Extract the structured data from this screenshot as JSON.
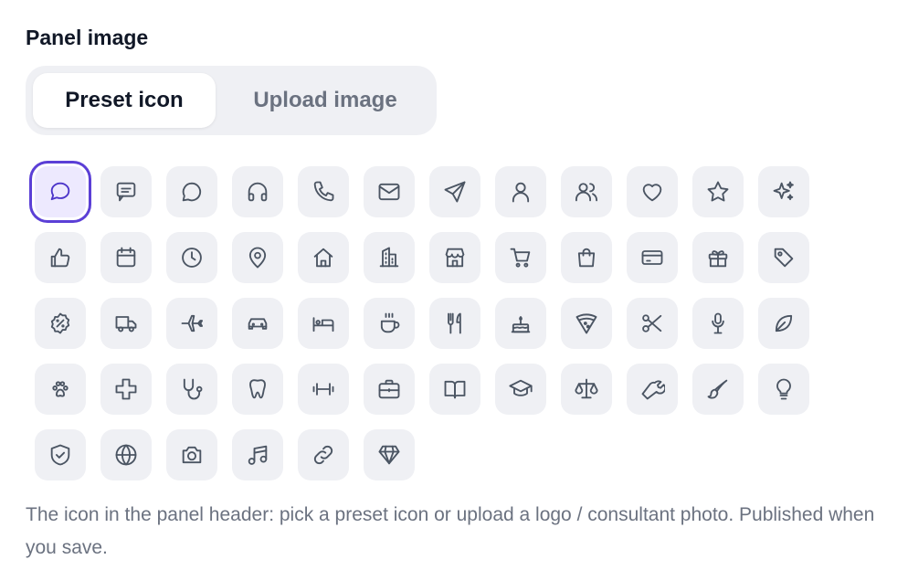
{
  "panel": {
    "title": "Panel image",
    "tabs": [
      {
        "label": "Preset icon",
        "active": true
      },
      {
        "label": "Upload image",
        "active": false
      }
    ],
    "selected_icon": "chat-bubble-icon",
    "icons": [
      "chat-bubble-icon",
      "message-square-icon",
      "message-circle-icon",
      "headphones-icon",
      "phone-icon",
      "mail-icon",
      "send-icon",
      "user-icon",
      "users-icon",
      "heart-icon",
      "star-icon",
      "sparkles-icon",
      "thumbs-up-icon",
      "calendar-icon",
      "clock-icon",
      "map-pin-icon",
      "home-icon",
      "building-icon",
      "store-icon",
      "shopping-cart-icon",
      "shopping-bag-icon",
      "credit-card-icon",
      "gift-icon",
      "tag-icon",
      "discount-badge-icon",
      "truck-icon",
      "plane-icon",
      "car-icon",
      "bed-icon",
      "coffee-icon",
      "utensils-icon",
      "cake-icon",
      "pizza-icon",
      "scissors-icon",
      "microphone-icon",
      "leaf-icon",
      "paw-icon",
      "medical-cross-icon",
      "stethoscope-icon",
      "tooth-icon",
      "dumbbell-icon",
      "briefcase-icon",
      "book-open-icon",
      "graduation-cap-icon",
      "scale-icon",
      "wrench-icon",
      "paintbrush-icon",
      "lightbulb-icon",
      "shield-check-icon",
      "globe-icon",
      "camera-icon",
      "music-icon",
      "link-icon",
      "gem-icon"
    ],
    "help_text": "The icon in the panel header: pick a preset icon or upload a logo / consultant photo. Published when you save.",
    "colors": {
      "accent": "#5b3fd6",
      "tile_bg": "#eff0f4",
      "selected_bg": "#ede9fe",
      "muted_text": "#6b7280"
    }
  }
}
